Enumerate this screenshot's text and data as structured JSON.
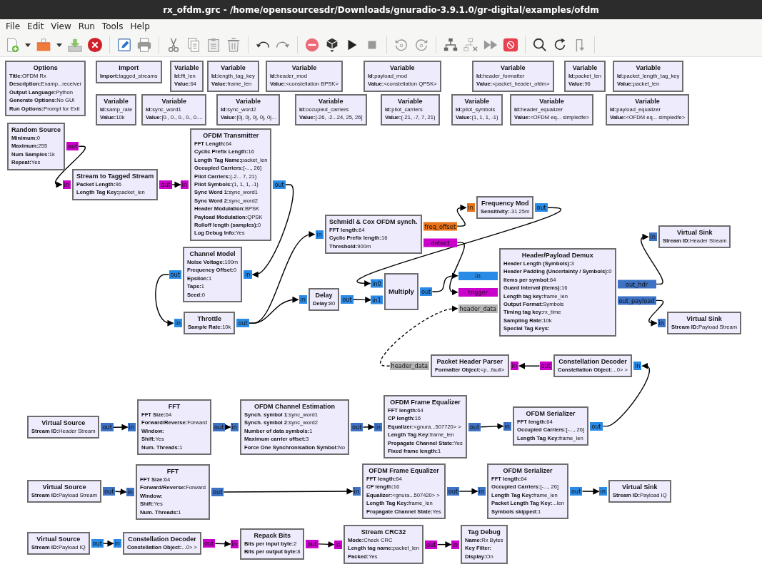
{
  "window": {
    "title": "rx_ofdm.grc - /home/opensourcesdr/Downloads/gnuradio-3.9.1.0/gr-digital/examples/ofdm"
  },
  "menu": [
    "File",
    "Edit",
    "View",
    "Run",
    "Tools",
    "Help"
  ],
  "blocks": [
    {
      "title": "Options",
      "params": [
        {
          "label": "Title:",
          "value": "OFDM Rx"
        },
        {
          "label": "Description:",
          "value": "Examp...receiver"
        },
        {
          "label": "Output Language:",
          "value": "Python"
        },
        {
          "label": "Generate Options:",
          "value": "No GUI"
        },
        {
          "label": "Run Options:",
          "value": "Prompt for Exit"
        }
      ]
    },
    {
      "title": "Import",
      "params": [
        {
          "label": "Import:",
          "value": "tagged_streams"
        }
      ]
    },
    {
      "title": "Variable",
      "params": [
        {
          "label": "Id:",
          "value": "fft_len"
        },
        {
          "label": "Value:",
          "value": "64"
        }
      ]
    },
    {
      "title": "Variable",
      "params": [
        {
          "label": "Id:",
          "value": "length_tag_key"
        },
        {
          "label": "Value:",
          "value": "frame_len"
        }
      ]
    },
    {
      "title": "Variable",
      "params": [
        {
          "label": "Id:",
          "value": "header_mod"
        },
        {
          "label": "Value:",
          "value": "<constellation BPSK>"
        }
      ]
    },
    {
      "title": "Variable",
      "params": [
        {
          "label": "Id:",
          "value": "payload_mod"
        },
        {
          "label": "Value:",
          "value": "<constellation QPSK>"
        }
      ]
    },
    {
      "title": "Variable",
      "params": [
        {
          "label": "Id:",
          "value": "header_formatter"
        },
        {
          "label": "Value:",
          "value": "<packet_header_ofdm>"
        }
      ]
    },
    {
      "title": "Variable",
      "params": [
        {
          "label": "Id:",
          "value": "packet_len"
        },
        {
          "label": "Value:",
          "value": "96"
        }
      ]
    },
    {
      "title": "Variable",
      "params": [
        {
          "label": "Id:",
          "value": "packet_length_tag_key"
        },
        {
          "label": "Value:",
          "value": "packet_len"
        }
      ]
    },
    {
      "title": "Variable",
      "params": [
        {
          "label": "Id:",
          "value": "samp_rate"
        },
        {
          "label": "Value:",
          "value": "10k"
        }
      ]
    },
    {
      "title": "Variable",
      "params": [
        {
          "label": "Id:",
          "value": "sync_word1"
        },
        {
          "label": "Value:",
          "value": "[0., 0., 0., 0., 0...."
        }
      ]
    },
    {
      "title": "Variable",
      "params": [
        {
          "label": "Id:",
          "value": "sync_word2"
        },
        {
          "label": "Value:",
          "value": "[0j, 0j, 0j, 0j, 0j..."
        }
      ]
    },
    {
      "title": "Variable",
      "params": [
        {
          "label": "Id:",
          "value": "occupied_carriers"
        },
        {
          "label": "Value:",
          "value": "[-26, -2...24, 25, 26]"
        }
      ]
    },
    {
      "title": "Variable",
      "params": [
        {
          "label": "Id:",
          "value": "pilot_carriers"
        },
        {
          "label": "Value:",
          "value": "(-21, -7, 7, 21)"
        }
      ]
    },
    {
      "title": "Variable",
      "params": [
        {
          "label": "Id:",
          "value": "pilot_symbols"
        },
        {
          "label": "Value:",
          "value": "(1, 1, 1, -1)"
        }
      ]
    },
    {
      "title": "Variable",
      "params": [
        {
          "label": "Id:",
          "value": "header_equalizer"
        },
        {
          "label": "Value:",
          "value": "<OFDM eq... simpledfe>"
        }
      ]
    },
    {
      "title": "Variable",
      "params": [
        {
          "label": "Id:",
          "value": "payload_equalizer"
        },
        {
          "label": "Value:",
          "value": "<OFDM eq... simpledfe>"
        }
      ]
    },
    {
      "title": "Random Source",
      "params": [
        {
          "label": "Minimum:",
          "value": "0"
        },
        {
          "label": "Maximum:",
          "value": "255"
        },
        {
          "label": "Num Samples:",
          "value": "1k"
        },
        {
          "label": "Repeat:",
          "value": "Yes"
        }
      ],
      "outputs": [
        {
          "label": "out",
          "color": "#cc00cc"
        }
      ]
    },
    {
      "title": "Stream to Tagged Stream",
      "params": [
        {
          "label": "Packet Length:",
          "value": "96"
        },
        {
          "label": "Length Tag Key:",
          "value": "packet_len"
        }
      ],
      "inputs": [
        {
          "label": "in",
          "color": "#cc00cc"
        }
      ],
      "outputs": [
        {
          "label": "out",
          "color": "#cc00cc"
        }
      ]
    },
    {
      "title": "OFDM Transmitter",
      "params": [
        {
          "label": "FFT Length:",
          "value": "64"
        },
        {
          "label": "Cyclic Prefix Length:",
          "value": "16"
        },
        {
          "label": "Length Tag Name:",
          "value": "packet_len"
        },
        {
          "label": "Occupied Carriers:",
          "value": "[-..., 26]"
        },
        {
          "label": "Pilot Carriers:",
          "value": "(-2... 7, 21)"
        },
        {
          "label": "Pilot Symbols:",
          "value": "(1, 1, 1, -1)"
        },
        {
          "label": "Sync Word 1:",
          "value": "sync_word1"
        },
        {
          "label": "Sync Word 2:",
          "value": "sync_word2"
        },
        {
          "label": "Header Modulation:",
          "value": "BPSK"
        },
        {
          "label": "Payload Modulation:",
          "value": "QPSK"
        },
        {
          "label": "Rolloff length (samples):",
          "value": "0"
        },
        {
          "label": "Log Debug Info:",
          "value": "Yes"
        }
      ],
      "inputs": [
        {
          "label": "in",
          "color": "#cc00cc"
        }
      ],
      "outputs": [
        {
          "label": "out",
          "color": "#2a8be6"
        }
      ]
    },
    {
      "title": "Channel Model",
      "params": [
        {
          "label": "Noise Voltage:",
          "value": "100m"
        },
        {
          "label": "Frequency Offset:",
          "value": "0"
        },
        {
          "label": "Epsilon:",
          "value": "1"
        },
        {
          "label": "Taps:",
          "value": "1"
        },
        {
          "label": "Seed:",
          "value": "0"
        }
      ],
      "inputs": [
        {
          "label": "in",
          "color": "#2a8be6"
        }
      ],
      "outputs": [
        {
          "label": "out",
          "color": "#2a8be6"
        }
      ]
    },
    {
      "title": "Throttle",
      "params": [
        {
          "label": "Sample Rate:",
          "value": "10k"
        }
      ],
      "inputs": [
        {
          "label": "in",
          "color": "#2a8be6"
        }
      ],
      "outputs": [
        {
          "label": "out",
          "color": "#2a8be6"
        }
      ]
    },
    {
      "title": "Schmidl & Cox OFDM synch.",
      "params": [
        {
          "label": "FFT length:",
          "value": "64"
        },
        {
          "label": "Cyclic Prefix length:",
          "value": "16"
        },
        {
          "label": "Threshold:",
          "value": "900m"
        }
      ],
      "inputs": [
        {
          "label": "in",
          "color": "#2a8be6"
        }
      ],
      "outputs": [
        {
          "label": "freq_offset",
          "color": "#e8731a"
        },
        {
          "label": "detect",
          "color": "#cc00cc"
        }
      ]
    },
    {
      "title": "Delay",
      "params": [
        {
          "label": "Delay:",
          "value": "80"
        }
      ],
      "inputs": [
        {
          "label": "in",
          "color": "#2a8be6"
        }
      ],
      "outputs": [
        {
          "label": "out",
          "color": "#2a8be6"
        }
      ]
    },
    {
      "title": "Frequency Mod",
      "params": [
        {
          "label": "Sensitivity:",
          "value": "-31.25m"
        }
      ],
      "inputs": [
        {
          "label": "in",
          "color": "#e8731a"
        }
      ],
      "outputs": [
        {
          "label": "out",
          "color": "#2a8be6"
        }
      ]
    },
    {
      "title": "Multiply",
      "inputs": [
        {
          "label": "in0",
          "color": "#2a8be6"
        },
        {
          "label": "in1",
          "color": "#2a8be6"
        }
      ],
      "outputs": [
        {
          "label": "out",
          "color": "#2a8be6"
        }
      ]
    },
    {
      "title": "Header/Payload Demux",
      "params": [
        {
          "label": "Header Length (Symbols):",
          "value": "3"
        },
        {
          "label": "Header Padding (Uncertainty / Symbols):",
          "value": "0"
        },
        {
          "label": "Items per symbol:",
          "value": "64"
        },
        {
          "label": "Guard Interval (items):",
          "value": "16"
        },
        {
          "label": "Length tag key:",
          "value": "frame_len"
        },
        {
          "label": "Output Format:",
          "value": "Symbols"
        },
        {
          "label": "Timing tag key:",
          "value": "rx_time"
        },
        {
          "label": "Sampling Rate:",
          "value": "10k"
        },
        {
          "label": "Special Tag Keys:"
        }
      ],
      "inputs": [
        {
          "label": "in",
          "color": "#2a8be6"
        },
        {
          "label": "trigger",
          "color": "#cc00cc"
        },
        {
          "label": "header_data",
          "color": "#b4b4b4"
        }
      ],
      "outputs": [
        {
          "label": "out_hdr",
          "color": "#3d72c4"
        },
        {
          "label": "out_payload",
          "color": "#3d72c4"
        }
      ]
    },
    {
      "title": "Virtual Sink",
      "params": [
        {
          "label": "Stream ID:",
          "value": "Header Stream"
        }
      ],
      "inputs": [
        {
          "label": "in",
          "color": "#3d72c4"
        }
      ]
    },
    {
      "title": "Virtual Sink",
      "params": [
        {
          "label": "Stream ID:",
          "value": "Payload Stream"
        }
      ],
      "inputs": [
        {
          "label": "in",
          "color": "#3d72c4"
        }
      ]
    },
    {
      "title": "Packet Header Parser",
      "params": [
        {
          "label": "Formatter Object:",
          "value": "<p...fault>"
        }
      ],
      "inputs": [
        {
          "label": "in",
          "color": "#cc00cc"
        }
      ],
      "outputs": [
        {
          "label": "header_data",
          "color": "#b4b4b4"
        }
      ]
    },
    {
      "title": "Constellation Decoder",
      "params": [
        {
          "label": "Constellation Object:",
          "value": "...0> >"
        }
      ],
      "inputs": [
        {
          "label": "in",
          "color": "#2a8be6"
        }
      ],
      "outputs": [
        {
          "label": "out",
          "color": "#cc00cc"
        }
      ]
    },
    {
      "title": "Virtual Source",
      "params": [
        {
          "label": "Stream ID:",
          "value": "Header Stream"
        }
      ],
      "outputs": [
        {
          "label": "out",
          "color": "#3d72c4"
        }
      ]
    },
    {
      "title": "FFT",
      "params": [
        {
          "label": "FFT Size:",
          "value": "64"
        },
        {
          "label": "Forward/Reverse:",
          "value": "Forward"
        },
        {
          "label": "Window:"
        },
        {
          "label": "Shift:",
          "value": "Yes"
        },
        {
          "label": "Num. Threads:",
          "value": "1"
        }
      ],
      "inputs": [
        {
          "label": "in",
          "color": "#3d72c4"
        }
      ],
      "outputs": [
        {
          "label": "out",
          "color": "#3d72c4"
        }
      ]
    },
    {
      "title": "OFDM Channel Estimation",
      "params": [
        {
          "label": "Synch. symbol 1:",
          "value": "sync_word1"
        },
        {
          "label": "Synch. symbol 2:",
          "value": "sync_word2"
        },
        {
          "label": "Number of data symbols:",
          "value": "1"
        },
        {
          "label": "Maximum carrier offset:",
          "value": "3"
        },
        {
          "label": "Force One Synchronisation Symbol:",
          "value": "No"
        }
      ],
      "inputs": [
        {
          "label": "in",
          "color": "#3d72c4"
        }
      ],
      "outputs": [
        {
          "label": "out",
          "color": "#3d72c4"
        }
      ]
    },
    {
      "title": "OFDM Frame Equalizer",
      "params": [
        {
          "label": "FFT length:",
          "value": "64"
        },
        {
          "label": "CP length:",
          "value": "16"
        },
        {
          "label": "Equalizer:",
          "value": "<gnura...507720> >"
        },
        {
          "label": "Length Tag Key:",
          "value": "frame_len"
        },
        {
          "label": "Propagate Channel State:",
          "value": "Yes"
        },
        {
          "label": "Fixed frame length:",
          "value": "1"
        }
      ],
      "inputs": [
        {
          "label": "in",
          "color": "#3d72c4"
        }
      ],
      "outputs": [
        {
          "label": "out",
          "color": "#3d72c4"
        }
      ]
    },
    {
      "title": "OFDM Serializer",
      "params": [
        {
          "label": "FFT length:",
          "value": "64"
        },
        {
          "label": "Occupied Carriers:",
          "value": "[-..., 26]"
        },
        {
          "label": "Length Tag Key:",
          "value": "frame_len"
        }
      ],
      "inputs": [
        {
          "label": "in",
          "color": "#3d72c4"
        }
      ],
      "outputs": [
        {
          "label": "out",
          "color": "#2a8be6"
        }
      ]
    },
    {
      "title": "Virtual Source",
      "params": [
        {
          "label": "Stream ID:",
          "value": "Payload Stream"
        }
      ],
      "outputs": [
        {
          "label": "out",
          "color": "#3d72c4"
        }
      ]
    },
    {
      "title": "FFT",
      "params": [
        {
          "label": "FFT Size:",
          "value": "64"
        },
        {
          "label": "Forward/Reverse:",
          "value": "Forward"
        },
        {
          "label": "Window:"
        },
        {
          "label": "Shift:",
          "value": "Yes"
        },
        {
          "label": "Num. Threads:",
          "value": "1"
        }
      ],
      "inputs": [
        {
          "label": "in",
          "color": "#3d72c4"
        }
      ],
      "outputs": [
        {
          "label": "out",
          "color": "#3d72c4"
        }
      ]
    },
    {
      "title": "OFDM Frame Equalizer",
      "params": [
        {
          "label": "FFT length:",
          "value": "64"
        },
        {
          "label": "CP length:",
          "value": "16"
        },
        {
          "label": "Equalizer:",
          "value": "<gnura...507420> >"
        },
        {
          "label": "Length Tag Key:",
          "value": "frame_len"
        },
        {
          "label": "Propagate Channel State:",
          "value": "Yes"
        }
      ],
      "inputs": [
        {
          "label": "in",
          "color": "#3d72c4"
        }
      ],
      "outputs": [
        {
          "label": "out",
          "color": "#3d72c4"
        }
      ]
    },
    {
      "title": "OFDM Serializer",
      "params": [
        {
          "label": "FFT length:",
          "value": "64"
        },
        {
          "label": "Occupied Carriers:",
          "value": "[-..., 26]"
        },
        {
          "label": "Length Tag Key:",
          "value": "frame_len"
        },
        {
          "label": "Packet Length Tag Key:",
          "value": "...len"
        },
        {
          "label": "Symbols skipped:",
          "value": "1"
        }
      ],
      "inputs": [
        {
          "label": "in",
          "color": "#3d72c4"
        }
      ],
      "outputs": [
        {
          "label": "out",
          "color": "#2a8be6"
        }
      ]
    },
    {
      "title": "Virtual Sink",
      "params": [
        {
          "label": "Stream ID:",
          "value": "Payload IQ"
        }
      ],
      "inputs": [
        {
          "label": "in",
          "color": "#2a8be6"
        }
      ]
    },
    {
      "title": "Virtual Source",
      "params": [
        {
          "label": "Stream ID:",
          "value": "Payload IQ"
        }
      ],
      "outputs": [
        {
          "label": "out",
          "color": "#2a8be6"
        }
      ]
    },
    {
      "title": "Constellation Decoder",
      "params": [
        {
          "label": "Constellation Object:",
          "value": "...0> >"
        }
      ],
      "inputs": [
        {
          "label": "in",
          "color": "#2a8be6"
        }
      ],
      "outputs": [
        {
          "label": "out",
          "color": "#cc00cc"
        }
      ]
    },
    {
      "title": "Repack Bits",
      "params": [
        {
          "label": "Bits per input byte:",
          "value": "2"
        },
        {
          "label": "Bits per output byte:",
          "value": "8"
        }
      ],
      "inputs": [
        {
          "label": "in",
          "color": "#cc00cc"
        }
      ],
      "outputs": [
        {
          "label": "out",
          "color": "#cc00cc"
        }
      ]
    },
    {
      "title": "Stream CRC32",
      "params": [
        {
          "label": "Mode:",
          "value": "Check CRC"
        },
        {
          "label": "Length tag name:",
          "value": "packet_len"
        },
        {
          "label": "Packed:",
          "value": "Yes"
        }
      ],
      "inputs": [
        {
          "label": "in",
          "color": "#cc00cc"
        }
      ],
      "outputs": [
        {
          "label": "out",
          "color": "#cc00cc"
        }
      ]
    },
    {
      "title": "Tag Debug",
      "params": [
        {
          "label": "Name:",
          "value": "Rx Bytes"
        },
        {
          "label": "Key Filter:"
        },
        {
          "label": "Display:",
          "value": "On"
        }
      ],
      "inputs": [
        {
          "label": "in",
          "color": "#cc00cc"
        }
      ]
    }
  ]
}
